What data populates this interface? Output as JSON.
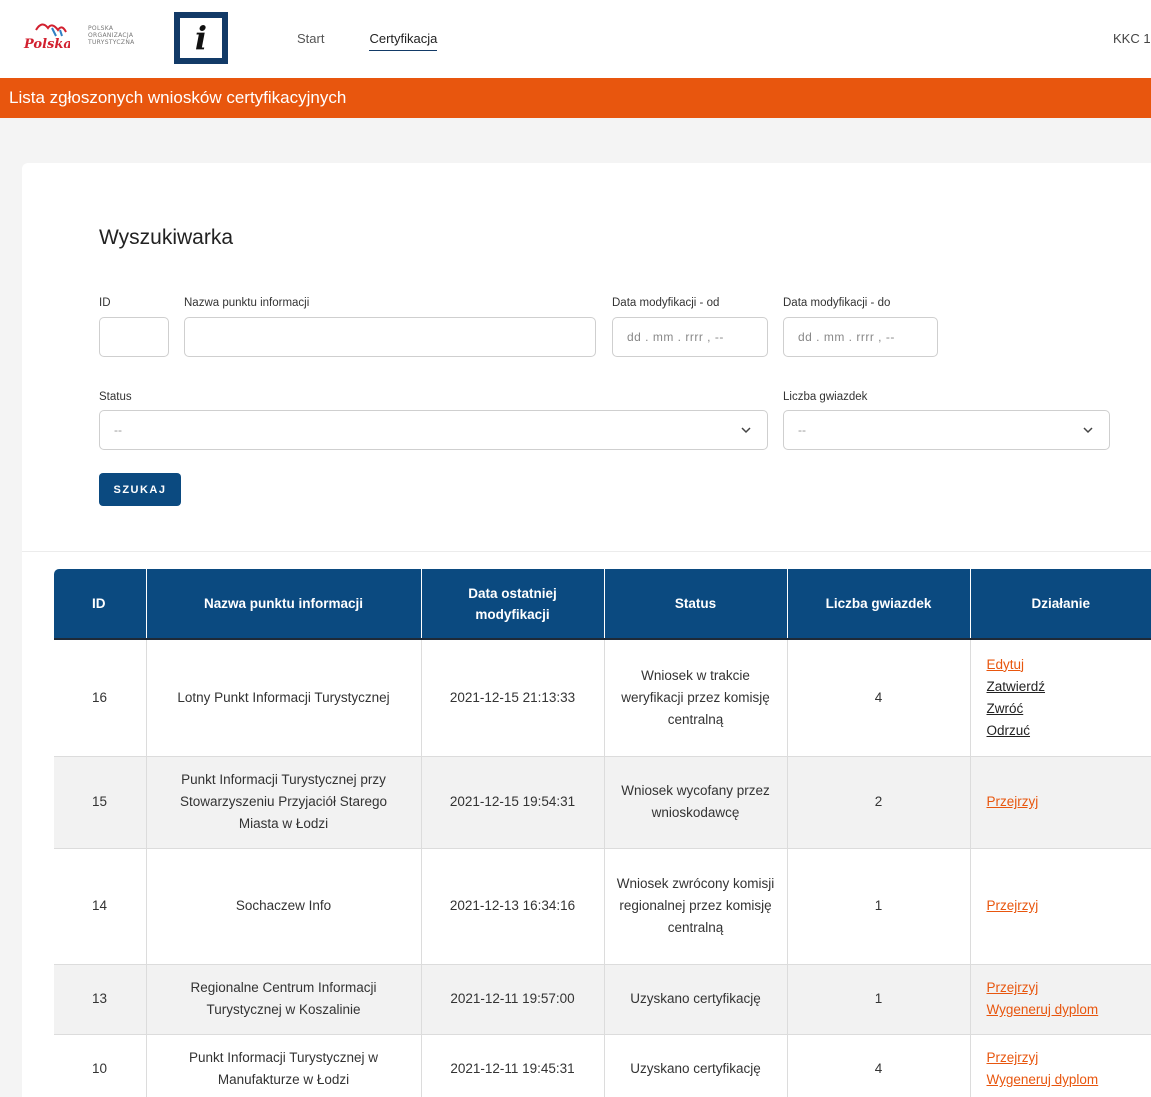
{
  "header": {
    "org_lines": [
      "POLSKA",
      "ORGANIZACJA",
      "TURYSTYCZNA"
    ],
    "info_letter": "i",
    "nav": [
      {
        "label": "Start",
        "active": false
      },
      {
        "label": "Certyfikacja",
        "active": true
      }
    ],
    "user_code": "KKC 1"
  },
  "banner": {
    "title": "Lista zgłoszonych wniosków certyfikacyjnych"
  },
  "search": {
    "title": "Wyszukiwarka",
    "id_label": "ID",
    "name_label": "Nazwa punktu informacji",
    "date_from_label": "Data modyfikacji - od",
    "date_to_label": "Data modyfikacji - do",
    "date_placeholder": "dd . mm . rrrr ,  --",
    "status_label": "Status",
    "status_value": "--",
    "stars_label": "Liczba gwiazdek",
    "stars_value": "--",
    "button_label": "SZUKAJ"
  },
  "table": {
    "headers": {
      "id": "ID",
      "name": "Nazwa punktu informacji",
      "date": "Data ostatniej modyfikacji",
      "status": "Status",
      "stars": "Liczba gwiazdek",
      "action": "Działanie"
    },
    "rows": [
      {
        "id": "16",
        "name": "Lotny Punkt Informacji Turystycznej",
        "date": "2021-12-15 21:13:33",
        "status": "Wniosek w trakcie weryfikacji przez komisję centralną",
        "stars": "4",
        "actions": [
          {
            "label": "Edytuj",
            "style": "orange"
          },
          {
            "label": "Zatwierdź",
            "style": "dark"
          },
          {
            "label": "Zwróć",
            "style": "dark"
          },
          {
            "label": "Odrzuć",
            "style": "dark"
          }
        ]
      },
      {
        "id": "15",
        "name": "Punkt Informacji Turystycznej przy Stowarzyszeniu Przyjaciół Starego Miasta w Łodzi",
        "date": "2021-12-15 19:54:31",
        "status": "Wniosek wycofany przez wnioskodawcę",
        "stars": "2",
        "actions": [
          {
            "label": "Przejrzyj",
            "style": "orange"
          }
        ]
      },
      {
        "id": "14",
        "name": "Sochaczew Info",
        "date": "2021-12-13 16:34:16",
        "status": "Wniosek zwrócony komisji regionalnej przez komisję centralną",
        "stars": "1",
        "actions": [
          {
            "label": "Przejrzyj",
            "style": "orange"
          }
        ]
      },
      {
        "id": "13",
        "name": "Regionalne Centrum Informacji Turystycznej w Koszalinie",
        "date": "2021-12-11 19:57:00",
        "status": "Uzyskano certyfikację",
        "stars": "1",
        "actions": [
          {
            "label": "Przejrzyj",
            "style": "orange"
          },
          {
            "label": "Wygeneruj dyplom",
            "style": "orange"
          }
        ]
      },
      {
        "id": "10",
        "name": "Punkt Informacji Turystycznej w Manufakturze w Łodzi",
        "date": "2021-12-11 19:45:31",
        "status": "Uzyskano certyfikację",
        "stars": "4",
        "actions": [
          {
            "label": "Przejrzyj",
            "style": "orange"
          },
          {
            "label": "Wygeneruj dyplom",
            "style": "orange"
          }
        ]
      }
    ]
  },
  "colors": {
    "accent_orange": "#e8560e",
    "brand_blue": "#0b4a80"
  }
}
